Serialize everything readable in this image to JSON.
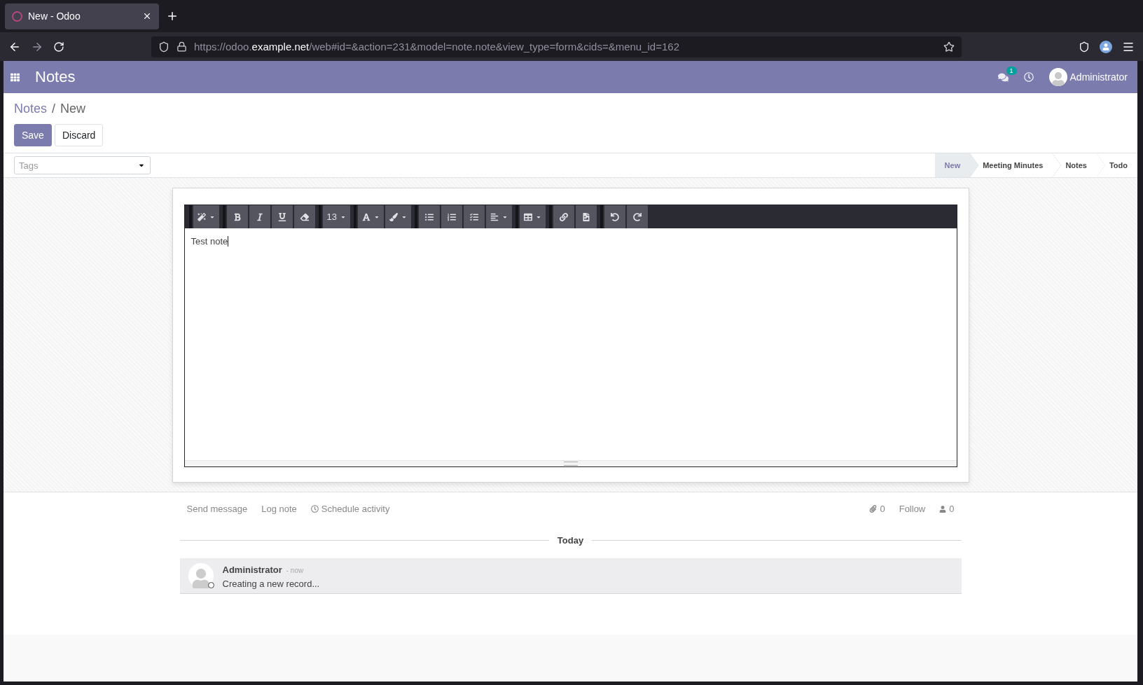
{
  "browser": {
    "tab_title": "New - Odoo",
    "url": {
      "scheme": "https://odoo.",
      "host": "example.net",
      "path": "/web#id=&action=231&model=note.note&view_type=form&cids=&menu_id=162"
    }
  },
  "navbar": {
    "app_name": "Notes",
    "message_count": "1",
    "user": "Administrator"
  },
  "breadcrumb_separator": "/",
  "breadcrumb": [
    {
      "label": "Notes",
      "kind": "link"
    },
    {
      "label": "New",
      "kind": "current"
    }
  ],
  "buttons": [
    {
      "label": "Save",
      "kind": "primary"
    },
    {
      "label": "Discard",
      "kind": "secondary"
    }
  ],
  "tags": {
    "placeholder": "Tags"
  },
  "stages": [
    {
      "label": "New",
      "selected": true
    },
    {
      "label": "Meeting Minutes",
      "selected": false
    },
    {
      "label": "Notes",
      "selected": false
    },
    {
      "label": "Todo",
      "selected": false
    }
  ],
  "toolbar": [
    [
      {
        "kind": "style",
        "dropdown": true
      }
    ],
    [
      {
        "kind": "bold",
        "dropdown": false
      },
      {
        "kind": "italic",
        "dropdown": false
      },
      {
        "kind": "underline",
        "dropdown": false
      },
      {
        "kind": "eraser",
        "dropdown": false
      }
    ],
    [
      {
        "kind": "font-size",
        "label": "13",
        "dropdown": true
      }
    ],
    [
      {
        "kind": "font-color",
        "dropdown": true
      },
      {
        "kind": "highlight",
        "dropdown": true
      }
    ],
    [
      {
        "kind": "bullet-list",
        "dropdown": false
      },
      {
        "kind": "numbered-list",
        "dropdown": false
      },
      {
        "kind": "task-list",
        "dropdown": false
      },
      {
        "kind": "align",
        "dropdown": true
      }
    ],
    [
      {
        "kind": "table",
        "dropdown": true
      }
    ],
    [
      {
        "kind": "link",
        "dropdown": false
      },
      {
        "kind": "image",
        "dropdown": false
      }
    ],
    [
      {
        "kind": "undo",
        "dropdown": false
      },
      {
        "kind": "redo",
        "dropdown": false
      }
    ]
  ],
  "editor": {
    "content": "Test note"
  },
  "chatter": {
    "actions": [
      {
        "label": "Send message",
        "kind": "text"
      },
      {
        "label": "Log note",
        "kind": "text"
      },
      {
        "label": "Schedule activity",
        "kind": "clock"
      }
    ],
    "attachments": "0",
    "follow": "Follow",
    "followers": "0",
    "date_separator": "Today",
    "messages": [
      {
        "author": "Administrator",
        "time": "- now",
        "body": "Creating a new record..."
      }
    ]
  }
}
